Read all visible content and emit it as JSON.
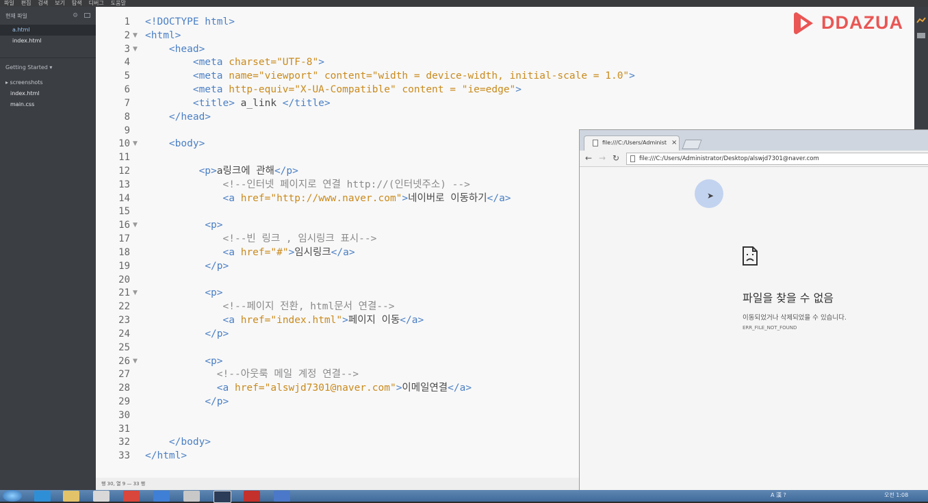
{
  "menu": [
    "파일",
    "편집",
    "검색",
    "보기",
    "탐색",
    "디버그",
    "도움말"
  ],
  "sidebar": {
    "header": "현재 파일",
    "working_files": [
      "a.html",
      "index.html"
    ],
    "project": "Getting Started ▾",
    "tree": [
      {
        "label": "▸ screenshots",
        "bold": false
      },
      {
        "label": "index.html",
        "bold": true
      },
      {
        "label": "main.css",
        "bold": true
      }
    ]
  },
  "editor": {
    "lines": [
      {
        "n": "1",
        "fold": false,
        "html": "<span class='tg'>&lt;!DOCTYPE html&gt;</span>"
      },
      {
        "n": "2",
        "fold": true,
        "html": "<span class='tg'>&lt;html&gt;</span>"
      },
      {
        "n": "3",
        "fold": true,
        "html": "    <span class='tg'>&lt;head&gt;</span>"
      },
      {
        "n": "4",
        "fold": false,
        "html": "        <span class='tg'>&lt;meta</span> <span class='at'>charset=</span><span class='st'>\"UTF-8\"</span><span class='tg'>&gt;</span>"
      },
      {
        "n": "5",
        "fold": false,
        "html": "        <span class='tg'>&lt;meta</span> <span class='at'>name=</span><span class='st'>\"viewport\"</span> <span class='at'>content=</span><span class='st'>\"width = device-width, initial-scale = 1.0\"</span><span class='tg'>&gt;</span>"
      },
      {
        "n": "6",
        "fold": false,
        "html": "        <span class='tg'>&lt;meta</span> <span class='at'>http-equiv=</span><span class='st'>\"X-UA-Compatible\"</span> <span class='at'>content = </span><span class='st'>\"ie=edge\"</span><span class='tg'>&gt;</span>"
      },
      {
        "n": "7",
        "fold": false,
        "html": "        <span class='tg'>&lt;title&gt;</span><span class='tx'> a_link </span><span class='tg'>&lt;/title&gt;</span>"
      },
      {
        "n": "8",
        "fold": false,
        "html": "    <span class='tg'>&lt;/head&gt;</span>"
      },
      {
        "n": "9",
        "fold": false,
        "html": ""
      },
      {
        "n": "10",
        "fold": true,
        "html": "    <span class='tg'>&lt;body&gt;</span>"
      },
      {
        "n": "11",
        "fold": false,
        "html": ""
      },
      {
        "n": "12",
        "fold": false,
        "html": "         <span class='tg'>&lt;p&gt;</span><span class='tx'>a링크에 관해</span><span class='tg'>&lt;/p&gt;</span>"
      },
      {
        "n": "13",
        "fold": false,
        "html": "             <span class='cm'>&lt;!--인터넷 페이지로 연결 http://(인터넷주소) --&gt;</span>"
      },
      {
        "n": "14",
        "fold": false,
        "html": "             <span class='tg'>&lt;a</span> <span class='at'>href=</span><span class='st'>\"http://www.naver.com\"</span><span class='tg'>&gt;</span><span class='tx'>네이버로 이동하기</span><span class='tg'>&lt;/a&gt;</span>"
      },
      {
        "n": "15",
        "fold": false,
        "html": ""
      },
      {
        "n": "16",
        "fold": true,
        "html": "          <span class='tg'>&lt;p&gt;</span>"
      },
      {
        "n": "17",
        "fold": false,
        "html": "             <span class='cm'>&lt;!--빈 링크 , 임시링크 표시--&gt;</span>"
      },
      {
        "n": "18",
        "fold": false,
        "html": "             <span class='tg'>&lt;a</span> <span class='at'>href=</span><span class='st'>\"#\"</span><span class='tg'>&gt;</span><span class='tx'>임시링크</span><span class='tg'>&lt;/a&gt;</span>"
      },
      {
        "n": "19",
        "fold": false,
        "html": "          <span class='tg'>&lt;/p&gt;</span>"
      },
      {
        "n": "20",
        "fold": false,
        "html": ""
      },
      {
        "n": "21",
        "fold": true,
        "html": "          <span class='tg'>&lt;p&gt;</span>"
      },
      {
        "n": "22",
        "fold": false,
        "html": "             <span class='cm'>&lt;!--페이지 전환, html문서 연결--&gt;</span>"
      },
      {
        "n": "23",
        "fold": false,
        "html": "             <span class='tg'>&lt;a</span> <span class='at'>href=</span><span class='st'>\"index.html\"</span><span class='tg'>&gt;</span><span class='tx'>페이지 이동</span><span class='tg'>&lt;/a&gt;</span>"
      },
      {
        "n": "24",
        "fold": false,
        "html": "          <span class='tg'>&lt;/p&gt;</span>"
      },
      {
        "n": "25",
        "fold": false,
        "html": ""
      },
      {
        "n": "26",
        "fold": true,
        "html": "          <span class='tg'>&lt;p&gt;</span>"
      },
      {
        "n": "27",
        "fold": false,
        "html": "            <span class='cm'>&lt;!--아웃룩 메일 계정 연결--&gt;</span>"
      },
      {
        "n": "28",
        "fold": false,
        "html": "            <span class='tg'>&lt;a</span> <span class='at'>href=</span><span class='st'>\"alswjd7301@naver.com\"</span><span class='tg'>&gt;</span><span class='tx'>이메일연결</span><span class='tg'>&lt;/a&gt;</span>"
      },
      {
        "n": "29",
        "fold": false,
        "html": "          <span class='tg'>&lt;/p&gt;</span>"
      },
      {
        "n": "30",
        "fold": false,
        "html": ""
      },
      {
        "n": "31",
        "fold": false,
        "html": ""
      },
      {
        "n": "32",
        "fold": false,
        "html": "    <span class='tg'>&lt;/body&gt;</span>"
      },
      {
        "n": "33",
        "fold": false,
        "html": "<span class='tg'>&lt;/html&gt;</span>"
      }
    ]
  },
  "logo": {
    "text": "DDAZUA",
    "color": "#e95654"
  },
  "statusbar": {
    "text": "행 30, 열 9 — 33 행"
  },
  "browser": {
    "tab_title": "file:///C:/Users/Administ",
    "url": "file:///C:/Users/Administrator/Desktop/alswjd7301@naver.com",
    "error_title": "파일을 찾을 수 없음",
    "error_desc": "이동되었거나 삭제되었을 수 있습니다.",
    "error_code": "ERR_FILE_NOT_FOUND"
  },
  "taskbar": {
    "tray": "A 漢 ?",
    "clock": "오전 1:08"
  },
  "colors": {
    "tag": "#4a7fc4",
    "attr": "#c98a1c",
    "comment": "#8a8a8a",
    "sidebar": "#3b3e43"
  }
}
